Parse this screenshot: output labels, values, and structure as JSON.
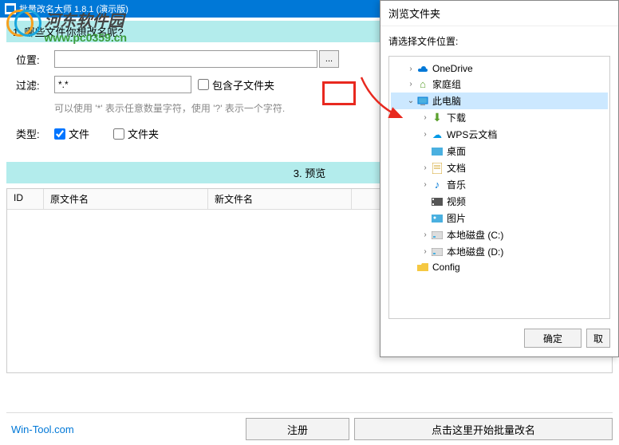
{
  "title_bar": "批量改名大师 1.8.1 (演示版)",
  "watermark": {
    "title": "河东软件园",
    "url": "www.pc0359.cn"
  },
  "section1": {
    "header": "1. 哪些文件你想改名呢?",
    "location_label": "位置:",
    "location_value": "",
    "browse_btn": "...",
    "filter_label": "过滤:",
    "filter_value": "*.*",
    "include_subfolder": "包含子文件夹",
    "hint": "可以使用 '*' 表示任意数量字符，使用 '?' 表示一个字符.",
    "type_label": "类型:",
    "type_file": "文件",
    "type_folder": "文件夹"
  },
  "preview": {
    "header": "3. 预览",
    "col_id": "ID",
    "col_original": "原文件名",
    "col_new": "新文件名"
  },
  "bottom": {
    "site": "Win-Tool.com",
    "register": "注册",
    "start": "点击这里开始批量改名"
  },
  "browse_dialog": {
    "title": "浏览文件夹",
    "prompt": "请选择文件位置:",
    "tree": [
      {
        "indent": 1,
        "arrow": "›",
        "icon": "onedrive",
        "label": "OneDrive"
      },
      {
        "indent": 1,
        "arrow": "›",
        "icon": "family",
        "label": "家庭组"
      },
      {
        "indent": 1,
        "arrow": "⌄",
        "icon": "pc",
        "label": "此电脑",
        "selected": true
      },
      {
        "indent": 2,
        "arrow": "›",
        "icon": "download",
        "label": "下载"
      },
      {
        "indent": 2,
        "arrow": "›",
        "icon": "wps",
        "label": "WPS云文档"
      },
      {
        "indent": 2,
        "arrow": "",
        "icon": "desktop",
        "label": "桌面"
      },
      {
        "indent": 2,
        "arrow": "›",
        "icon": "doc",
        "label": "文档"
      },
      {
        "indent": 2,
        "arrow": "›",
        "icon": "music",
        "label": "音乐"
      },
      {
        "indent": 2,
        "arrow": "",
        "icon": "video",
        "label": "视频"
      },
      {
        "indent": 2,
        "arrow": "",
        "icon": "pic",
        "label": "图片"
      },
      {
        "indent": 2,
        "arrow": "›",
        "icon": "disk",
        "label": "本地磁盘 (C:)"
      },
      {
        "indent": 2,
        "arrow": "›",
        "icon": "disk",
        "label": "本地磁盘 (D:)"
      },
      {
        "indent": 1,
        "arrow": "",
        "icon": "folder",
        "label": "Config"
      }
    ],
    "ok": "确定",
    "cancel": "取"
  }
}
